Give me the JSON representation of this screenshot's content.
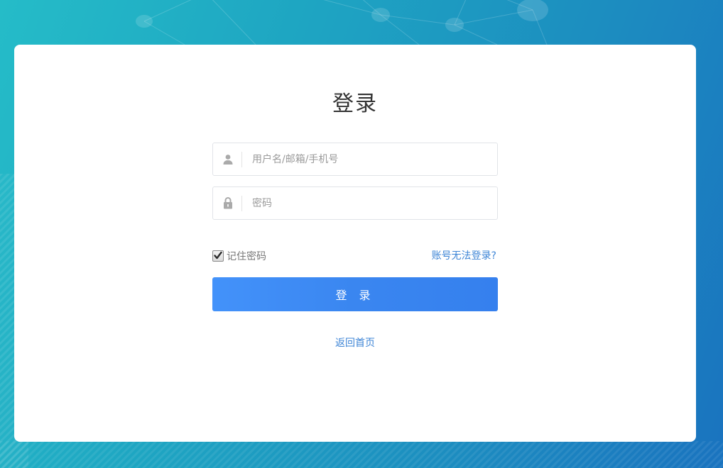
{
  "login": {
    "title": "登录",
    "username_placeholder": "用户名/邮箱/手机号",
    "username_value": "",
    "password_placeholder": "密码",
    "password_value": "",
    "remember_label": "记住密码",
    "remember_checked": true,
    "forgot_link": "账号无法登录?",
    "submit_label": "登 录",
    "back_home_link": "返回首页"
  },
  "icons": {
    "username": "user-icon",
    "password": "lock-icon",
    "checkbox": "check-icon"
  },
  "colors": {
    "background_start": "#25bcc8",
    "background_end": "#1a73bf",
    "button": "#3a86f0",
    "link": "#3e85d6",
    "icon": "#aaaaaa"
  }
}
